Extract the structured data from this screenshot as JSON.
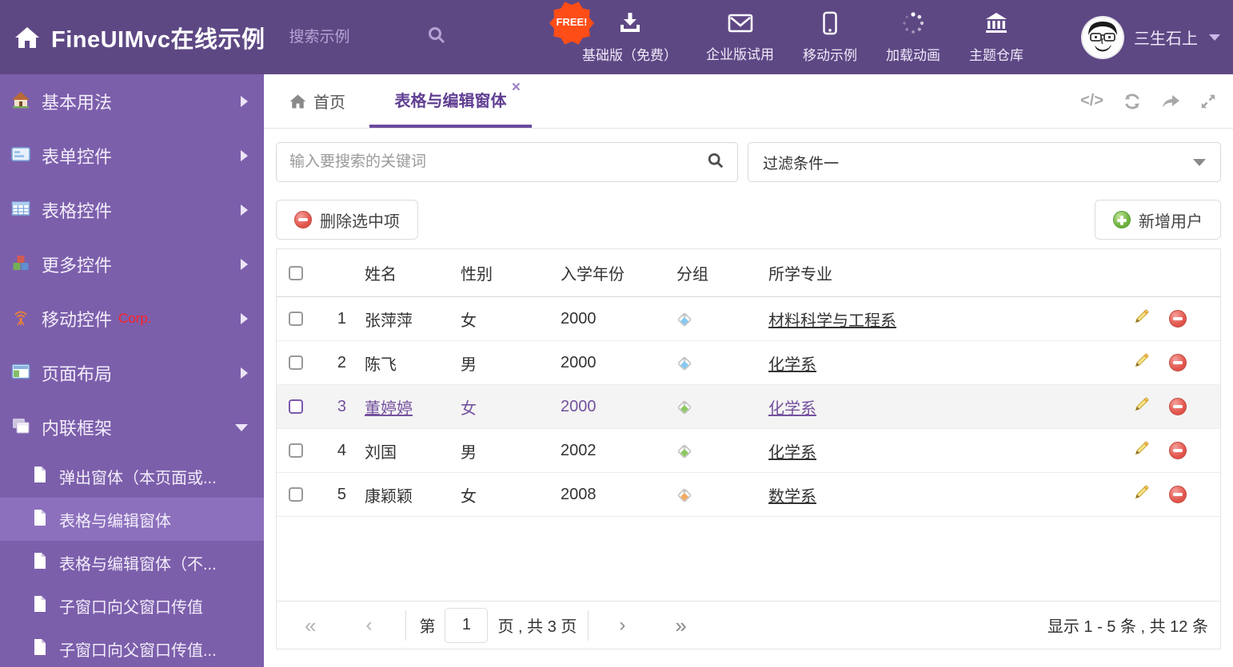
{
  "header": {
    "title": "FineUIMvc在线示例",
    "search_placeholder": "搜索示例",
    "free_badge": "FREE!",
    "nav": [
      {
        "label": "基础版（免费）"
      },
      {
        "label": "企业版试用"
      },
      {
        "label": "移动示例"
      },
      {
        "label": "加载动画"
      },
      {
        "label": "主题仓库"
      }
    ],
    "username": "三生石上"
  },
  "sidebar": {
    "items": [
      {
        "label": "基本用法"
      },
      {
        "label": "表单控件"
      },
      {
        "label": "表格控件"
      },
      {
        "label": "更多控件"
      },
      {
        "label": "移动控件",
        "badge": "Corp."
      },
      {
        "label": "页面布局"
      },
      {
        "label": "内联框架"
      }
    ],
    "subitems": [
      {
        "label": "弹出窗体（本页面或..."
      },
      {
        "label": "表格与编辑窗体"
      },
      {
        "label": "表格与编辑窗体（不..."
      },
      {
        "label": "子窗口向父窗口传值"
      },
      {
        "label": "子窗口向父窗口传值..."
      }
    ]
  },
  "tabs": {
    "home_label": "首页",
    "active_label": "表格与编辑窗体",
    "close_glyph": "×",
    "code_glyph": "</>"
  },
  "search": {
    "placeholder": "输入要搜索的关键词"
  },
  "filter": {
    "value": "过滤条件一"
  },
  "toolbar": {
    "delete_label": "删除选中项",
    "add_label": "新增用户"
  },
  "table": {
    "columns": {
      "name": "姓名",
      "gender": "性别",
      "year": "入学年份",
      "group": "分组",
      "major": "所学专业"
    },
    "rows": [
      {
        "num": "1",
        "name": "张萍萍",
        "gender": "女",
        "year": "2000",
        "tag": "#85c8f2",
        "major": "材料科学与工程系"
      },
      {
        "num": "2",
        "name": "陈飞",
        "gender": "男",
        "year": "2000",
        "tag": "#85c8f2",
        "major": "化学系"
      },
      {
        "num": "3",
        "name": "董婷婷",
        "gender": "女",
        "year": "2000",
        "tag": "#8dc863",
        "major": "化学系"
      },
      {
        "num": "4",
        "name": "刘国",
        "gender": "男",
        "year": "2002",
        "tag": "#8dc863",
        "major": "化学系"
      },
      {
        "num": "5",
        "name": "康颖颖",
        "gender": "女",
        "year": "2008",
        "tag": "#f3aa62",
        "major": "数学系"
      }
    ]
  },
  "pagination": {
    "first_glyph": "«",
    "prev_glyph": "‹",
    "next_glyph": "›",
    "last_glyph": "»",
    "page_label_prefix": "第",
    "page_value": "1",
    "page_label_suffix": "页 , 共 3 页",
    "summary": "显示 1 - 5 条 , 共 12 条"
  },
  "colors": {
    "header_bg": "#5e4884",
    "sidebar_bg": "#7c5fab",
    "sidebar_selected": "#8c70bd",
    "accent": "#6a4a9d",
    "free_badge": "#ff4d17",
    "delete_red": "#e2574e",
    "add_green": "#72b440"
  }
}
